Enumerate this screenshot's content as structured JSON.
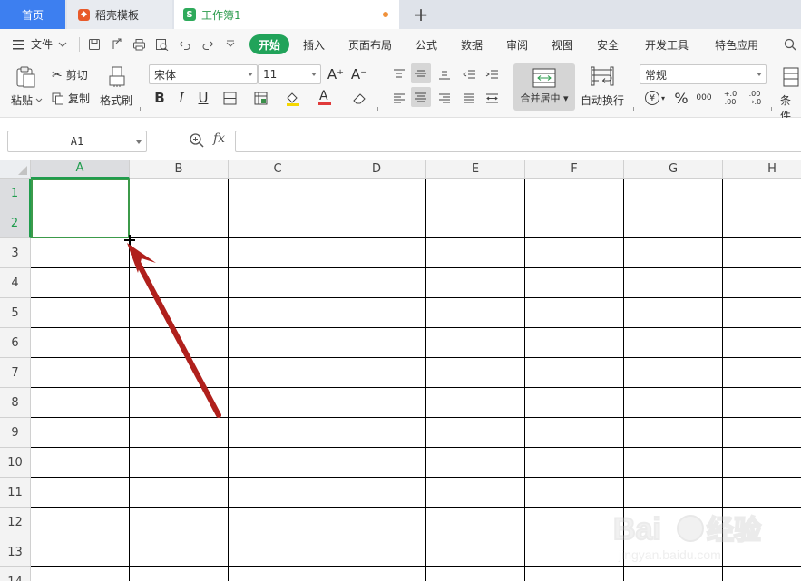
{
  "tabs": {
    "home": "首页",
    "daoke": "稻壳模板",
    "workbook": "工作簿1",
    "add": "+"
  },
  "menu": {
    "file": "文件",
    "items": [
      "开始",
      "插入",
      "页面布局",
      "公式",
      "数据",
      "审阅",
      "视图",
      "安全",
      "开发工具",
      "特色应用"
    ],
    "search_icon": "search-icon"
  },
  "ribbon": {
    "paste": "粘贴",
    "cut": "剪切",
    "copy": "复制",
    "format_painter": "格式刷",
    "font_name": "宋体",
    "font_size": "11",
    "grow_font": "A⁺",
    "shrink_font": "A⁻",
    "bold": "B",
    "italic": "I",
    "underline": "U",
    "font_color_letter": "A",
    "merge_center": "合并居中",
    "auto_wrap": "自动换行",
    "number_format": "常规",
    "currency": "¥",
    "percent": "%",
    "thousands": "000",
    "inc_decimal": "+.0 .00",
    "dec_decimal": ".00 →.0",
    "conditional": "条件",
    "font_color": "#e03a3a",
    "fill_color": "#f5d700"
  },
  "formula_bar": {
    "name_box": "A1",
    "fx": "fx",
    "formula": ""
  },
  "sheet": {
    "columns": [
      "A",
      "B",
      "C",
      "D",
      "E",
      "F",
      "G",
      "H"
    ],
    "rows": [
      "1",
      "2",
      "3",
      "4",
      "5",
      "6",
      "7",
      "8",
      "9",
      "10",
      "11",
      "12",
      "13",
      "14"
    ],
    "active_column": "A",
    "active_rows": [
      "1",
      "2"
    ],
    "selection_color": "#3c9a4a",
    "arrow_color": "#b0201c"
  }
}
